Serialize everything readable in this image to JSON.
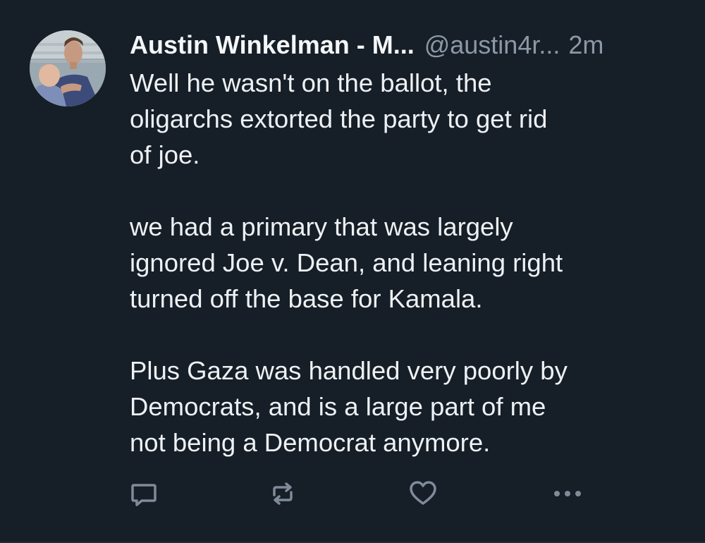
{
  "post": {
    "author": {
      "display_name": "Austin Winkelman - M...",
      "handle": "@austin4r...",
      "avatar_icon": "user-avatar-photo"
    },
    "timestamp": "2m",
    "body": {
      "paragraph_1": [
        "Well he wasn't on the ballot, the",
        "oligarchs extorted the party to get rid",
        "of joe."
      ],
      "paragraph_2": [
        "we had a primary that was largely",
        "ignored Joe v. Dean, and leaning right",
        "turned off the base for Kamala."
      ],
      "paragraph_3": [
        "Plus Gaza was handled very poorly by",
        "Democrats, and is a large part of me",
        "not being a Democrat anymore."
      ]
    },
    "actions": {
      "reply_icon": "reply-bubble-icon",
      "repost_icon": "repost-arrows-icon",
      "like_icon": "heart-icon",
      "more_icon": "more-dots-icon"
    }
  },
  "colors": {
    "background": "#161e27",
    "text": "#eef1f4",
    "secondary_text": "#8b98a5",
    "icon": "#7f8b99"
  }
}
